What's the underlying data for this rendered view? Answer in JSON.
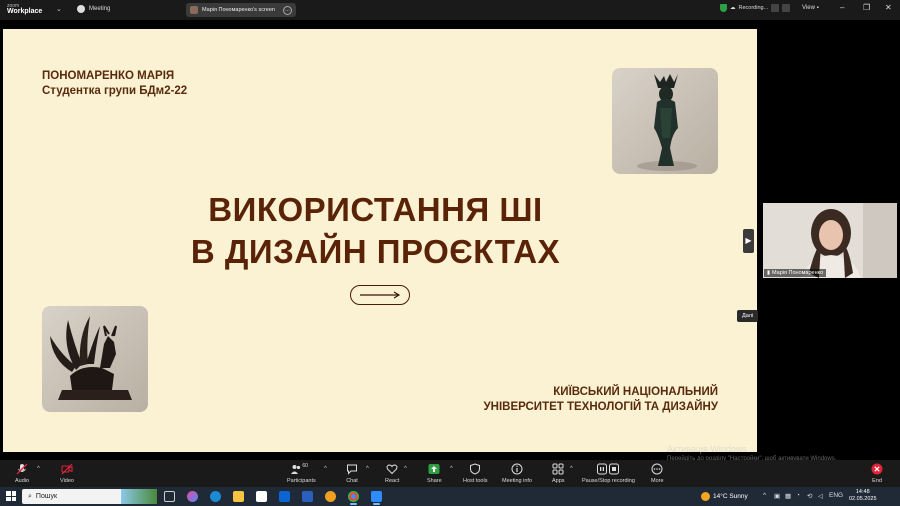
{
  "app": {
    "brand_line1": "zoom",
    "brand_line2": "Workplace",
    "meeting_label": "Meeting",
    "screen_share_label": "Марія Пономаренко's screen",
    "recording_label": "Recording...",
    "view_label": "View"
  },
  "slide": {
    "author_name": "ПОНОМАРЕНКО МАРІЯ",
    "author_group": "Студентка групи БДм2-22",
    "title_line1": "ВИКОРИСТАННЯ ШІ",
    "title_line2": "В ДИЗАЙН ПРОЄКТАХ",
    "uni_line1": "КИЇВСЬКИЙ НАЦІОНАЛЬНИЙ",
    "uni_line2": "УНІВЕРСИТЕТ ТЕХНОЛОГІЙ ТА ДИЗАЙНУ"
  },
  "participant": {
    "name": "Марія Пономаренко"
  },
  "tooltip": "Далі",
  "watermark": {
    "line1": "Активація Windows",
    "line2": "Перейдіть до розділу \"Настройки\", щоб активувати Windows."
  },
  "controls": {
    "audio": "Audio",
    "video": "Video",
    "participants": "Participants",
    "participants_count": "60",
    "chat": "Chat",
    "react": "React",
    "share": "Share",
    "host_tools": "Host tools",
    "meeting_info": "Meeting info",
    "apps": "Apps",
    "pause_stop_recording": "Pause/Stop recording",
    "more": "More",
    "end": "End"
  },
  "taskbar": {
    "search_placeholder": "Пошук",
    "weather": "14°C  Sunny",
    "language": "ENG",
    "time": "14:48",
    "date": "02.05.2025"
  },
  "colors": {
    "slide_bg": "#faf2d2",
    "slide_text": "#5a2308",
    "share_green": "#2ea043",
    "end_red": "#e0243a"
  }
}
